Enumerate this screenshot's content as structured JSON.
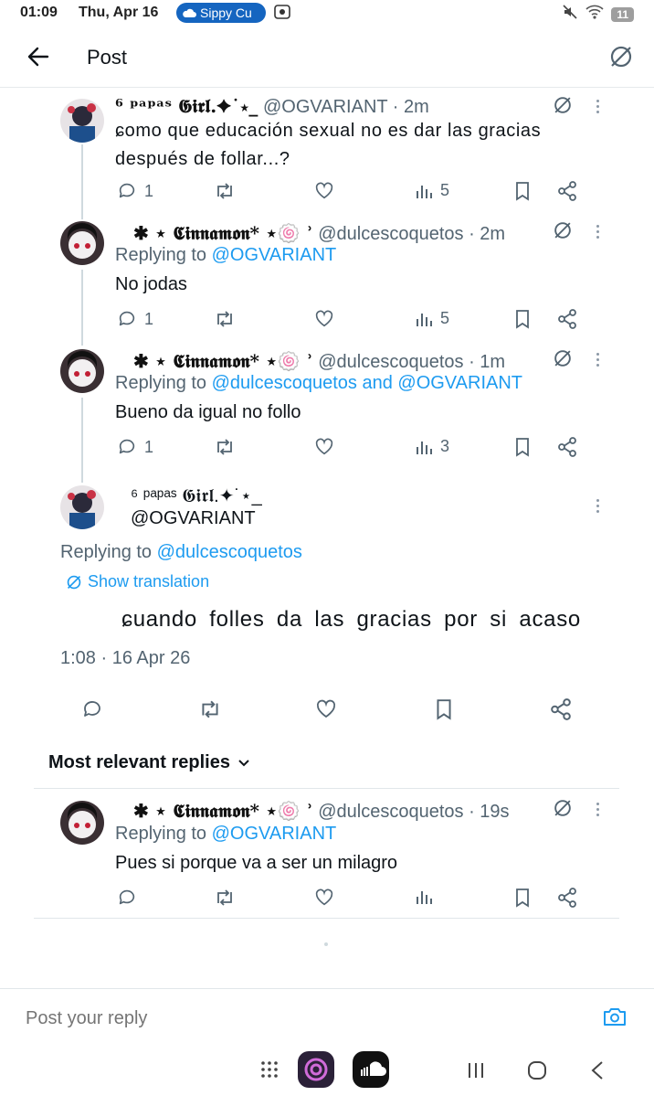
{
  "status_bar": {
    "time": "01:09",
    "date": "Thu, Apr 16",
    "media_pill": "Sippy Cu",
    "battery": "11"
  },
  "header": {
    "title": "Post"
  },
  "tweets": [
    {
      "display_name": "⁶ ᵖᵃᵖᵃˢ 𝕲𝖎𝖗𝖑.✦˙⋆_",
      "handle": "@OGVARIANT · 2m",
      "text": "ɕomo que educación sexual no es dar las gracias después de follar...?",
      "replies": "1",
      "views": "5"
    },
    {
      "display_name": "✱ ⋆ 𝕮𝖎𝖓𝖓𝖆𝖒𝖔𝖓* ⋆🍥 ʾ",
      "handle": "@dulcescoquetos · 2m",
      "reply_prefix": "Replying to ",
      "reply_to": "@OGVARIANT",
      "text": "No jodas",
      "replies": "1",
      "views": "5"
    },
    {
      "display_name": "✱ ⋆ 𝕮𝖎𝖓𝖓𝖆𝖒𝖔𝖓* ⋆🍥 ʾ",
      "handle": "@dulcescoquetos · 1m",
      "reply_prefix": "Replying to ",
      "reply_to": "@dulcescoquetos and @OGVARIANT",
      "text": "Bueno da igual no follo",
      "replies": "1",
      "views": "3"
    }
  ],
  "main_post": {
    "display_name": "⁶ ᵖᵃᵖᵃˢ 𝕲𝖎𝖗𝖑.✦˙⋆_",
    "handle": "@OGVARIANT",
    "reply_prefix": "Replying to ",
    "reply_to": "@dulcescoquetos",
    "show_translation": "Show translation",
    "text": "ɕuando folles da las gracias por si acaso",
    "timestamp": "1:08 · 16 Apr 26"
  },
  "sort": {
    "label": "Most relevant replies"
  },
  "reply": {
    "display_name": "✱ ⋆ 𝕮𝖎𝖓𝖓𝖆𝖒𝖔𝖓* ⋆🍥 ʾ",
    "handle": "@dulcescoquetos · 19s",
    "reply_prefix": "Replying to ",
    "reply_to": "@OGVARIANT",
    "text": "Pues si porque va a ser un milagro"
  },
  "composer": {
    "placeholder": "Post your reply"
  },
  "colors": {
    "accent": "#1d9bf0",
    "text": "#0f1419",
    "muted": "#536471"
  }
}
